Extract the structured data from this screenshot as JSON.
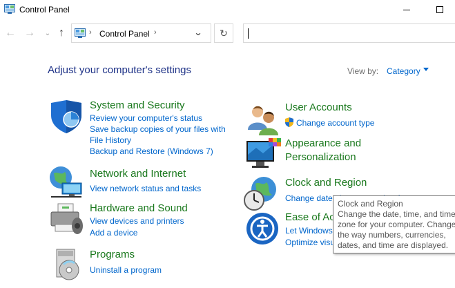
{
  "window": {
    "title": "Control Panel"
  },
  "nav": {
    "back_icon": "arrow-left-icon",
    "forward_icon": "arrow-right-icon",
    "recent_icon": "chevron-down-icon",
    "up_icon": "arrow-up-icon",
    "address_label": "Control Panel",
    "search_value": ""
  },
  "main": {
    "heading": "Adjust your computer's settings",
    "view_by_label": "View by:",
    "view_by_value": "Category"
  },
  "categories": [
    {
      "title": "System and Security",
      "icon": "shield-icon",
      "links": [
        "Review your computer's status",
        "Save backup copies of your files with",
        "File History",
        "Backup and Restore (Windows 7)"
      ]
    },
    {
      "title": "Network and Internet",
      "icon": "globe-network-icon",
      "links": [
        "View network status and tasks"
      ]
    },
    {
      "title": "Hardware and Sound",
      "icon": "printer-speaker-icon",
      "links": [
        "View devices and printers",
        "Add a device"
      ]
    },
    {
      "title": "Programs",
      "icon": "programs-disc-icon",
      "links": [
        "Uninstall a program"
      ]
    },
    {
      "title": "User Accounts",
      "icon": "users-icon",
      "links": [
        "Change account type"
      ]
    },
    {
      "title_line1": "Appearance and",
      "title_line2": "Personalization",
      "icon": "monitor-palette-icon",
      "links": []
    },
    {
      "title": "Clock and Region",
      "icon": "clock-globe-icon",
      "links": [
        "Change date, time, or number formats"
      ]
    },
    {
      "title": "Ease of Access",
      "icon": "ease-of-access-icon",
      "links": [
        "Let Windows suggest settings",
        "Optimize visual display"
      ]
    }
  ],
  "tooltip": {
    "title": "Clock and Region",
    "body": "Change the date, time, and time zone for your computer. Change the way numbers, currencies, dates, and time are displayed."
  }
}
